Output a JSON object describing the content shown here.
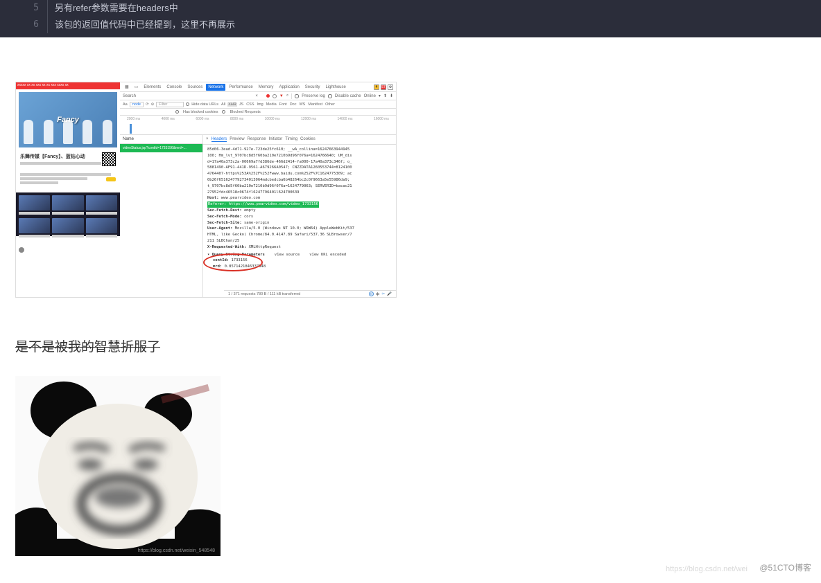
{
  "code": {
    "line5": {
      "no": "5",
      "text": "另有refer参数需要在headers中"
    },
    "line6": {
      "no": "6",
      "text": "该包的返回值代码中已经提到，这里不再展示"
    }
  },
  "video": {
    "fancy": "Fancy",
    "title": "乐舞传媒【Fancy】、蓝钻心动",
    "red_bar": "xxxxx xx xx xxx xx xx xxx xxxx xx"
  },
  "devtools": {
    "tabs": [
      "Elements",
      "Console",
      "Sources",
      "Network",
      "Performance",
      "Memory",
      "Application",
      "Security",
      "Lighthouse"
    ],
    "warn": "4",
    "err": "57",
    "search": "Search",
    "aa": "Aa",
    "regex": "node",
    "x": "×",
    "rec_opts": [
      "Preserve log",
      "Disable cache",
      "Online"
    ],
    "filter": "Filter",
    "hide": "Hide data URLs",
    "filter_types": [
      "All",
      "XHR",
      "JS",
      "CSS",
      "Img",
      "Media",
      "Font",
      "Doc",
      "WS",
      "Manifest",
      "Other"
    ],
    "blocked": [
      "Has blocked cookies",
      "Blocked Requests"
    ],
    "timeline": [
      "2000 ms",
      "4000 ms",
      "6000 ms",
      "8000 ms",
      "10000 ms",
      "12000 ms",
      "14000 ms",
      "16000 ms"
    ],
    "name_hdr": "Name",
    "green_req": "videoStatus.jsp?contId=1733156&mrd=...",
    "hp_tabs": [
      "Headers",
      "Preview",
      "Response",
      "Initiator",
      "Timing",
      "Cookies"
    ],
    "headers": {
      "l1": "85d06-3ead-4d71-927e-723de25fc610; __wA_collina=16247663944945",
      "l2": "100; Hm_lvt_9707bc8d5f60ba210e7210b9d96f076a=1624766640; UM_dis",
      "l3": "d=17a40a373c2a-00669a7fd386de-466d2414-fa000-17a40a373c346f; o_",
      "l4": "5881490-AF91-441D-9561-A679266A0547; CNZZDATA1260553744=8124100",
      "l5": "4764407-https%253A%252F%252Fwww.baidu.com%252F%7C1624775309; ac",
      "l6": "0b26f6516247792734013064mdcbedcba6b48264bc2c0f9663a5e55986da9;",
      "l7": "t_9707bc8d5f60ba210e7210b9d96f076a=1624779063; SERVERID=bacac21",
      "l8": "27952fdc46518c0674fl6247796401l624700639",
      "host_k": "Host:",
      "host_v": "www.pearvideo.com",
      "ref": "Referer: https://www.pearvideo.com/video_1733156",
      "sfd_k": "Sec-Fetch-Dest:",
      "sfd_v": "empty",
      "sfm_k": "Sec-Fetch-Mode:",
      "sfm_v": "cors",
      "sfs_k": "Sec-Fetch-Site:",
      "sfs_v": "same-origin",
      "ua_k": "User-Agent:",
      "ua_v": "Mozilla/5.0 (Windows NT 10.0; WOW64) AppleWebKit/537",
      "ua2": "HTML, like Gecko) Chrome/84.0.4147.89 Safari/537.36 SLBrowser/7",
      "ua3": "211 SLBChan/25",
      "xrw_k": "X-Requested-With:",
      "xrw_v": "XMLHttpRequest",
      "qsp": "Query String Parameters",
      "vs": "view source",
      "vue": "view URL encoded",
      "contId_k": "contId:",
      "contId_v": "1733156",
      "mrd_k": "mrd:",
      "mrd_v": "0.8571421846337948"
    },
    "status": "1 / 371 requests   780 B / 111 kB transferred",
    "sb_cn": "中"
  },
  "strike": "是不是被我的智慧折服了",
  "wm1": "@51CTO博客",
  "wm2": "https://blog.csdn.net/wei",
  "meme_wm": "https://blog.csdn.net/weixin_548548"
}
